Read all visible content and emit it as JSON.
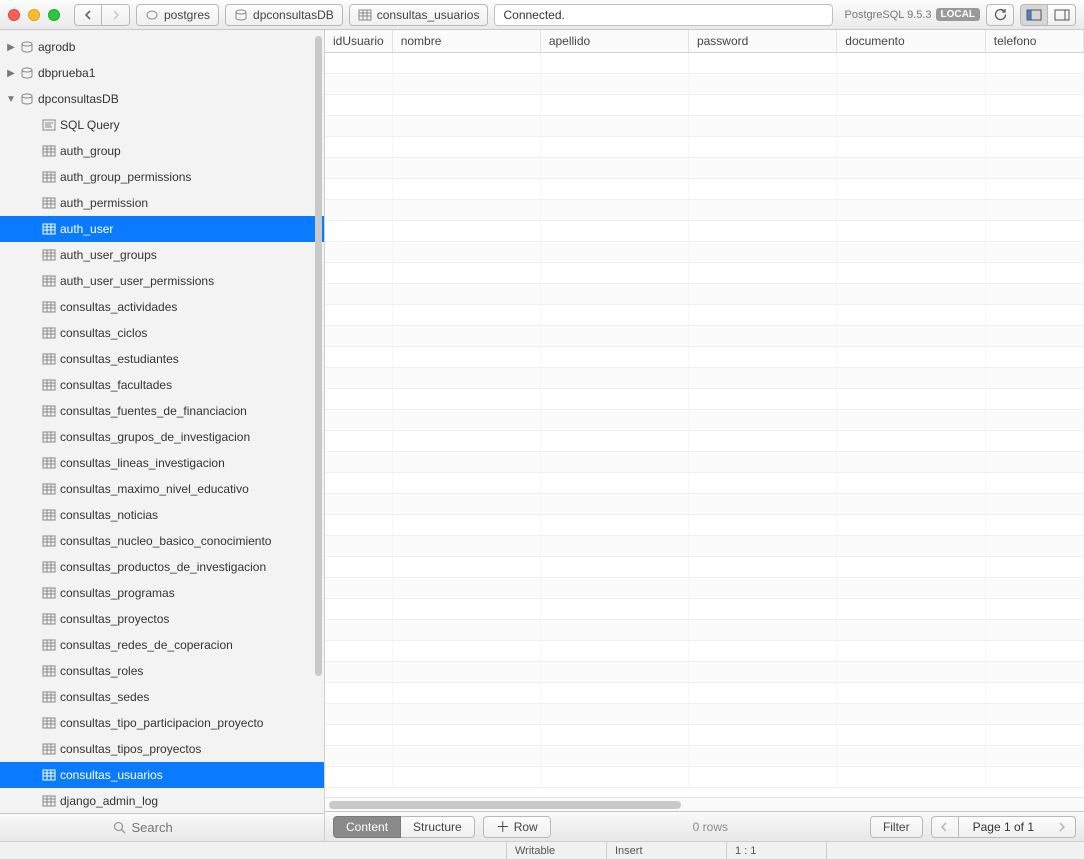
{
  "toolbar": {
    "status": "Connected.",
    "db_version": "PostgreSQL 9.5.3",
    "local_badge": "LOCAL"
  },
  "breadcrumbs": [
    {
      "label": "postgres",
      "icon": "elephant"
    },
    {
      "label": "dpconsultasDB",
      "icon": "db"
    },
    {
      "label": "consultas_usuarios",
      "icon": "table"
    }
  ],
  "sidebar": {
    "search_placeholder": "Search",
    "databases": [
      {
        "name": "agrodb",
        "expanded": false
      },
      {
        "name": "dbprueba1",
        "expanded": false
      },
      {
        "name": "dpconsultasDB",
        "expanded": true
      }
    ],
    "items": [
      {
        "label": "SQL Query",
        "type": "sql",
        "selected": false
      },
      {
        "label": "auth_group",
        "type": "table",
        "selected": false
      },
      {
        "label": "auth_group_permissions",
        "type": "table",
        "selected": false
      },
      {
        "label": "auth_permission",
        "type": "table",
        "selected": false
      },
      {
        "label": "auth_user",
        "type": "table",
        "selected": true
      },
      {
        "label": "auth_user_groups",
        "type": "table",
        "selected": false
      },
      {
        "label": "auth_user_user_permissions",
        "type": "table",
        "selected": false
      },
      {
        "label": "consultas_actividades",
        "type": "table",
        "selected": false
      },
      {
        "label": "consultas_ciclos",
        "type": "table",
        "selected": false
      },
      {
        "label": "consultas_estudiantes",
        "type": "table",
        "selected": false
      },
      {
        "label": "consultas_facultades",
        "type": "table",
        "selected": false
      },
      {
        "label": "consultas_fuentes_de_financiacion",
        "type": "table",
        "selected": false
      },
      {
        "label": "consultas_grupos_de_investigacion",
        "type": "table",
        "selected": false
      },
      {
        "label": "consultas_lineas_investigacion",
        "type": "table",
        "selected": false
      },
      {
        "label": "consultas_maximo_nivel_educativo",
        "type": "table",
        "selected": false
      },
      {
        "label": "consultas_noticias",
        "type": "table",
        "selected": false
      },
      {
        "label": "consultas_nucleo_basico_conocimiento",
        "type": "table",
        "selected": false
      },
      {
        "label": "consultas_productos_de_investigacion",
        "type": "table",
        "selected": false
      },
      {
        "label": "consultas_programas",
        "type": "table",
        "selected": false
      },
      {
        "label": "consultas_proyectos",
        "type": "table",
        "selected": false
      },
      {
        "label": "consultas_redes_de_coperacion",
        "type": "table",
        "selected": false
      },
      {
        "label": "consultas_roles",
        "type": "table",
        "selected": false
      },
      {
        "label": "consultas_sedes",
        "type": "table",
        "selected": false
      },
      {
        "label": "consultas_tipo_participacion_proyecto",
        "type": "table",
        "selected": false
      },
      {
        "label": "consultas_tipos_proyectos",
        "type": "table",
        "selected": false
      },
      {
        "label": "consultas_usuarios",
        "type": "table",
        "selected": true
      },
      {
        "label": "django_admin_log",
        "type": "table",
        "selected": false
      }
    ]
  },
  "table": {
    "columns": [
      "idUsuario",
      "nombre",
      "apellido",
      "password",
      "documento",
      "telefono"
    ],
    "row_count_label": "0 rows"
  },
  "bottom": {
    "content_label": "Content",
    "structure_label": "Structure",
    "row_label": "Row",
    "filter_label": "Filter",
    "page_label": "Page 1 of 1"
  },
  "statusbar": {
    "writable": "Writable",
    "mode": "Insert",
    "position": "1 : 1"
  }
}
